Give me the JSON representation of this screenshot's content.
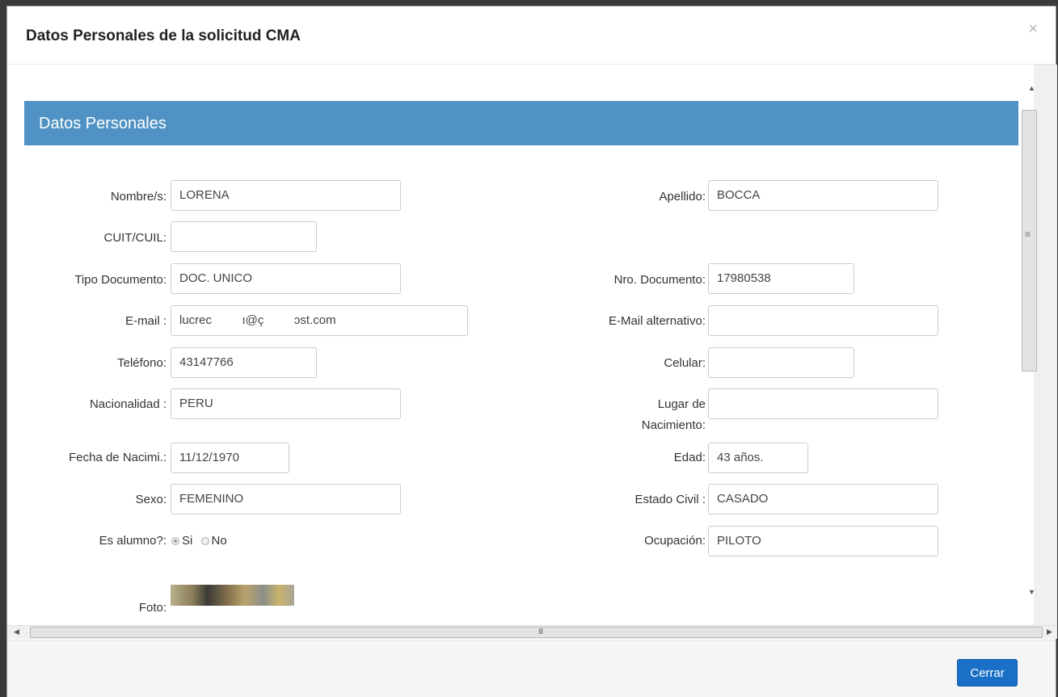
{
  "modal": {
    "title": "Datos Personales de la solicitud CMA",
    "close_glyph": "×",
    "close_button_label": "Cerrar"
  },
  "section": {
    "title": "Datos Personales"
  },
  "fields": {
    "nombre": {
      "label": "Nombre/s:",
      "value": "LORENA"
    },
    "apellido": {
      "label": "Apellido:",
      "value": "BOCCA"
    },
    "cuit": {
      "label": "CUIT/CUIL:",
      "value": ""
    },
    "tipo_documento": {
      "label": "Tipo Documento:",
      "value": "DOC. UNICO"
    },
    "nro_documento": {
      "label": "Nro. Documento:",
      "value": "17980538"
    },
    "email": {
      "label": "E-mail :",
      "value": "lucrec         ı@ç         ɔst.com"
    },
    "email_alt": {
      "label": "E-Mail alternativo:",
      "value": ""
    },
    "telefono": {
      "label": "Teléfono:",
      "value": "43147766"
    },
    "celular": {
      "label": "Celular:",
      "value": ""
    },
    "nacionalidad": {
      "label": "Nacionalidad :",
      "value": "PERU"
    },
    "lugar_nacimiento": {
      "label_line1": "Lugar de",
      "label_line2": "Nacimiento:",
      "value": ""
    },
    "fecha_nacimiento": {
      "label": "Fecha de Nacimi.:",
      "value": "11/12/1970"
    },
    "edad": {
      "label": "Edad:",
      "value": "43 años."
    },
    "sexo": {
      "label": "Sexo:",
      "value": "FEMENINO"
    },
    "estado_civil": {
      "label": "Estado Civil :",
      "value": "CASADO"
    },
    "es_alumno": {
      "label": "Es alumno?:",
      "option_si": "Si",
      "option_no": "No",
      "selected": "Si"
    },
    "ocupacion": {
      "label": "Ocupación:",
      "value": "PILOTO"
    },
    "foto": {
      "label": "Foto:"
    }
  },
  "scrollbars": {
    "up": "▲",
    "down": "▼",
    "left": "◀",
    "right": "▶",
    "v_grip": "≡",
    "h_grip": "III"
  },
  "colors": {
    "section_bar": "#4f92c3",
    "primary_button": "#1a6fc7"
  }
}
